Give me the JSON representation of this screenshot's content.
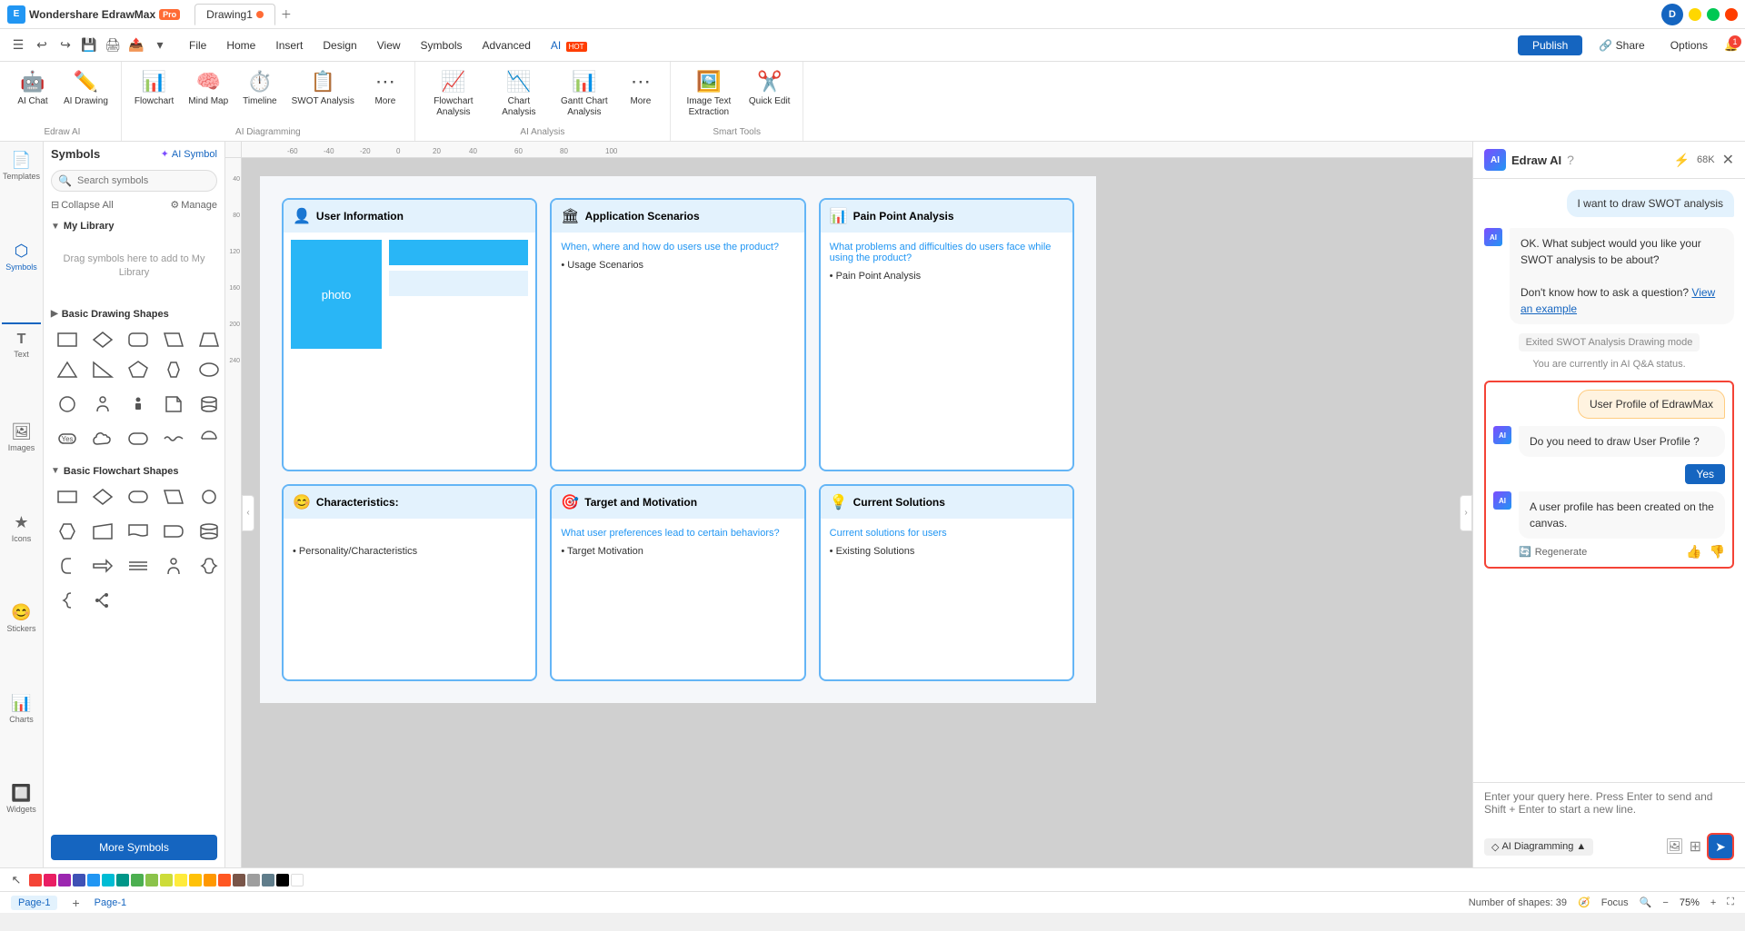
{
  "titleBar": {
    "appName": "Wondershare EdrawMax",
    "proBadge": "Pro",
    "tabs": [
      {
        "label": "Drawing1",
        "active": true,
        "modified": true
      }
    ],
    "userAvatar": "D"
  },
  "menuBar": {
    "menus": [
      "File",
      "Home",
      "Insert",
      "Design",
      "View",
      "Symbols",
      "Advanced"
    ],
    "aiLabel": "AI",
    "hotBadge": "HOT",
    "publishLabel": "Publish",
    "shareLabel": "Share",
    "optionsLabel": "Options"
  },
  "ribbon": {
    "groups": [
      {
        "label": "Edraw AI",
        "items": [
          {
            "icon": "🤖",
            "label": "AI Chat"
          },
          {
            "icon": "✏️",
            "label": "AI Drawing"
          }
        ]
      },
      {
        "label": "AI Diagramming",
        "items": [
          {
            "icon": "📊",
            "label": "Flowchart"
          },
          {
            "icon": "🧠",
            "label": "Mind Map"
          },
          {
            "icon": "⏱️",
            "label": "Timeline"
          },
          {
            "icon": "📋",
            "label": "SWOT Analysis"
          },
          {
            "icon": "⋯",
            "label": "More"
          }
        ]
      },
      {
        "label": "AI Analysis",
        "items": [
          {
            "icon": "📈",
            "label": "Flowchart Analysis"
          },
          {
            "icon": "📉",
            "label": "Chart Analysis"
          },
          {
            "icon": "📊",
            "label": "Gantt Chart Analysis"
          },
          {
            "icon": "⋯",
            "label": "More"
          }
        ]
      },
      {
        "label": "Smart Tools",
        "items": [
          {
            "icon": "🖼️",
            "label": "Image Text Extraction"
          },
          {
            "icon": "✂️",
            "label": "Quick Edit"
          }
        ]
      }
    ]
  },
  "leftPanel": {
    "tabs": [
      {
        "label": "Templates",
        "icon": "📄"
      },
      {
        "label": "Symbols",
        "icon": "⬡",
        "active": true
      },
      {
        "label": "Text",
        "icon": "T"
      },
      {
        "label": "Images",
        "icon": "🖼"
      },
      {
        "label": "Icons",
        "icon": "★"
      },
      {
        "label": "Stickers",
        "icon": "😊"
      },
      {
        "label": "Charts",
        "icon": "📊"
      },
      {
        "label": "Widgets",
        "icon": "🔲"
      }
    ],
    "symbols": {
      "title": "Symbols",
      "aiSymbolLabel": "AI Symbol",
      "searchPlaceholder": "Search symbols",
      "collapseAllLabel": "Collapse All",
      "manageLabel": "Manage",
      "myLibrary": {
        "title": "My Library",
        "placeholder": "Drag symbols here to add to My Library"
      },
      "basicDrawingShapes": {
        "title": "Basic Drawing Shapes"
      },
      "basicFlowchartShapes": {
        "title": "Basic Flowchart Shapes"
      },
      "moreSymbolsLabel": "More Symbols"
    }
  },
  "canvas": {
    "cards": [
      {
        "id": "user-info",
        "title": "User Information",
        "icon": "👤",
        "hasPhoto": true,
        "photoLabel": "photo"
      },
      {
        "id": "app-scenarios",
        "title": "Application Scenarios",
        "icon": "🏛",
        "subtitle": "When, where and how do users use the product?",
        "bullets": [
          "Usage Scenarios"
        ]
      },
      {
        "id": "pain-point",
        "title": "Pain Point Analysis",
        "icon": "📊",
        "subtitle": "What problems and difficulties do users face while using the product?",
        "bullets": [
          "Pain Point Analysis"
        ]
      },
      {
        "id": "characteristics",
        "title": "Characteristics:",
        "icon": "😊",
        "bullets": [
          "Personality/Characteristics"
        ]
      },
      {
        "id": "target-motivation",
        "title": "Target and Motivation",
        "icon": "🎯",
        "subtitle": "What user preferences lead to certain behaviors?",
        "bullets": [
          "Target Motivation"
        ]
      },
      {
        "id": "current-solutions",
        "title": "Current Solutions",
        "icon": "💡",
        "subtitle": "Current solutions for users",
        "bullets": [
          "Existing Solutions"
        ]
      }
    ]
  },
  "aiPanel": {
    "title": "Edraw AI",
    "helpIcon": "?",
    "tokenCount": "68K",
    "messages": [
      {
        "type": "user",
        "text": "I want to draw SWOT analysis"
      },
      {
        "type": "ai",
        "text": "OK. What subject would you like your SWOT analysis to be about?",
        "extra": {
          "question": "Don't know how to ask a question?",
          "linkText": "View an example"
        }
      },
      {
        "type": "system",
        "text": "Exited SWOT Analysis Drawing mode"
      },
      {
        "type": "status",
        "text": "You are currently in AI Q&A status."
      },
      {
        "type": "user-highlight",
        "text": "User Profile of EdrawMax"
      },
      {
        "type": "ai",
        "text": "Do you need to draw User Profile ?",
        "hasYesBtn": true,
        "yesBtnLabel": "Yes"
      },
      {
        "type": "ai",
        "text": "A user profile has been created on the canvas.",
        "hasRegenerate": true,
        "regenerateLabel": "Regenerate"
      }
    ],
    "inputPlaceholder": "Enter your query here. Press Enter to send and Shift + Enter to start a new line.",
    "modes": {
      "current": "AI Diagramming",
      "chevron": "▲"
    },
    "sendIcon": "➤"
  },
  "statusBar": {
    "pageLabel": "Page-1",
    "addPageLabel": "+",
    "shapesCount": "Number of shapes: 39",
    "focusLabel": "Focus",
    "zoomLevel": "75%"
  },
  "colors": {
    "accent": "#1565C0",
    "highlight": "#29b6f6",
    "cardBorder": "#64b5f6",
    "aiGradientStart": "#7c4dff",
    "aiGradientEnd": "#2196F3",
    "alertRed": "#f44336"
  }
}
